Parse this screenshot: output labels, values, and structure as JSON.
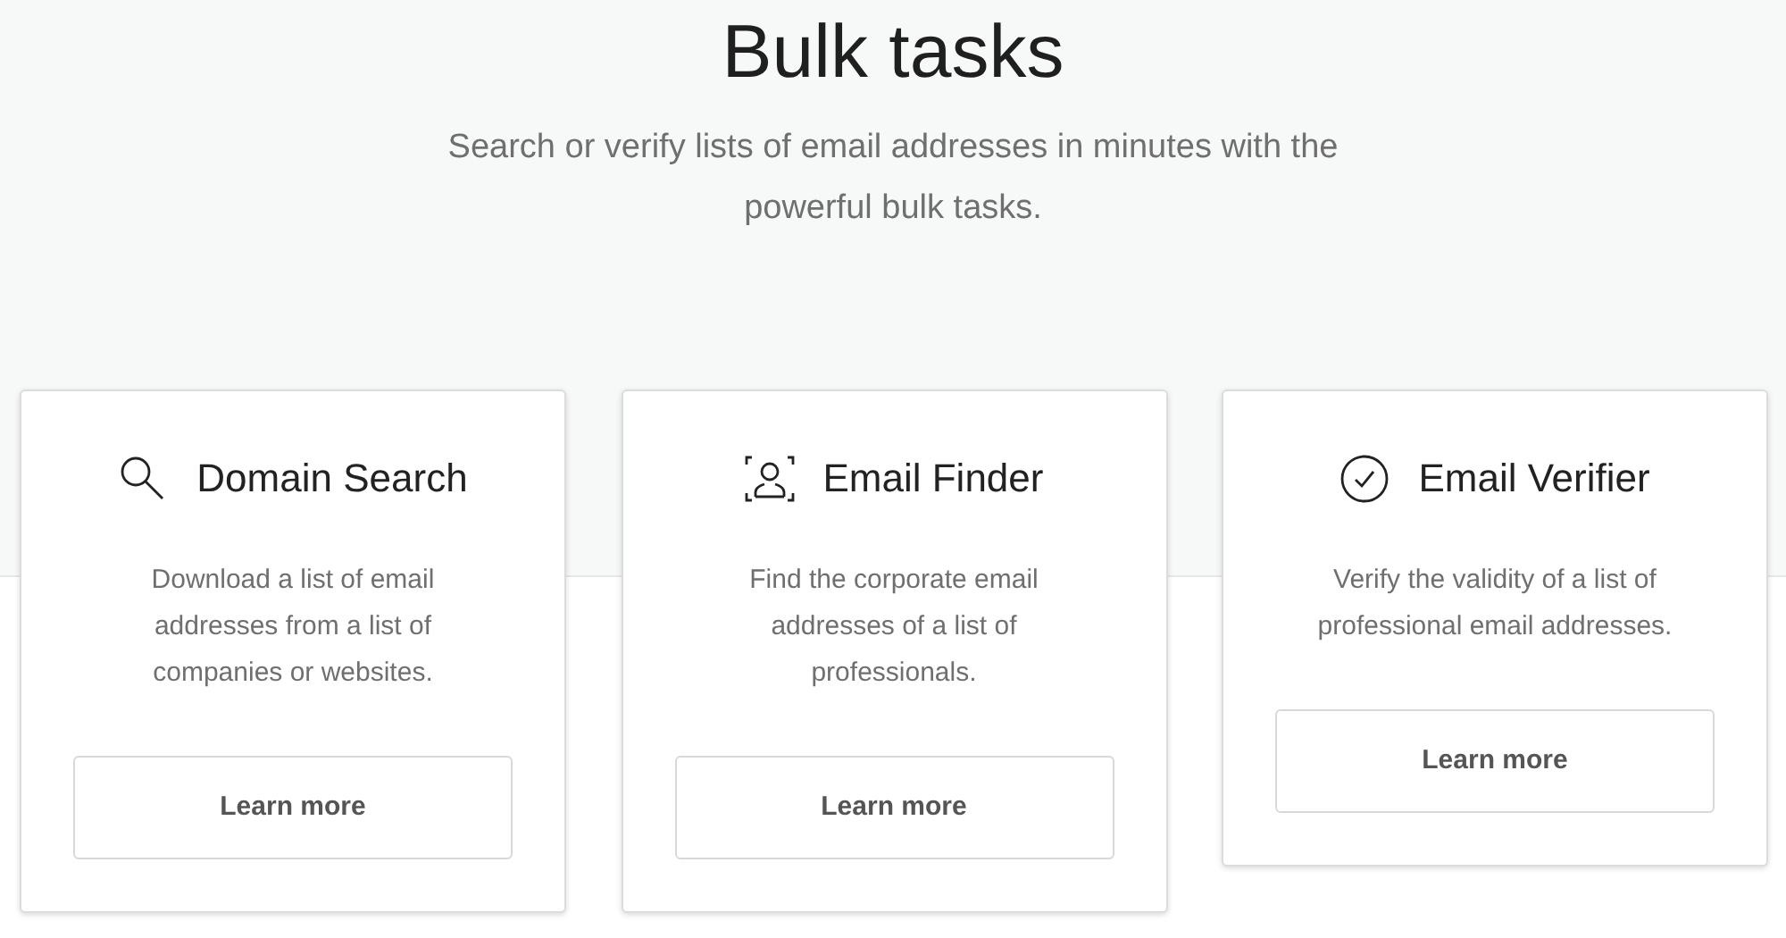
{
  "header": {
    "title": "Bulk tasks",
    "subtitle": "Search or verify lists of email addresses in minutes with the powerful bulk tasks."
  },
  "cards": [
    {
      "kind": "search",
      "title": "Domain Search",
      "description": "Download a list of email addresses from a list of companies or websites.",
      "button": "Learn more"
    },
    {
      "kind": "person",
      "title": "Email Finder",
      "description": "Find the corporate email addresses of a list of professionals.",
      "button": "Learn more"
    },
    {
      "kind": "check",
      "title": "Email Verifier",
      "description": "Verify the validity of a list of professional email addresses.",
      "button": "Learn more"
    }
  ]
}
